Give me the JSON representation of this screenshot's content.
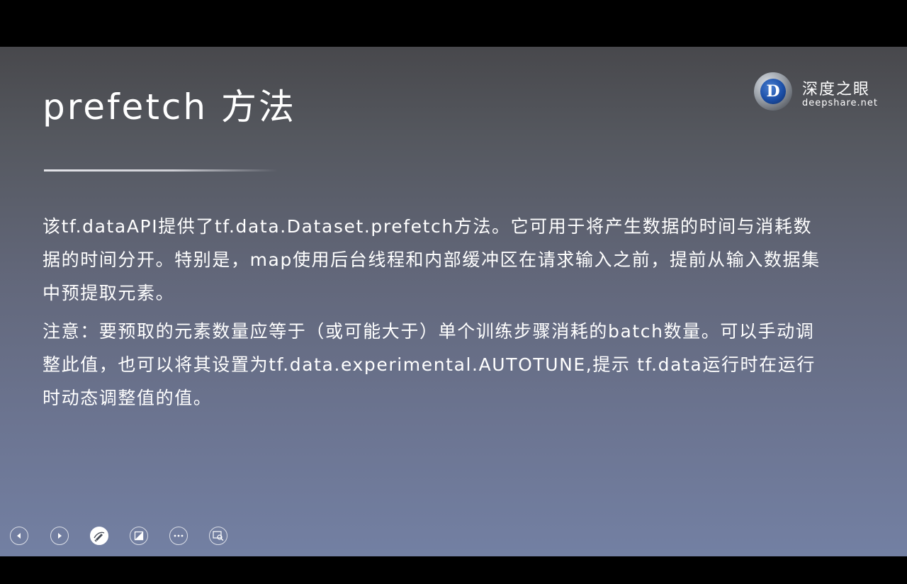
{
  "slide": {
    "title": "prefetch 方法",
    "paragraphs": [
      "该tf.dataAPI提供了tf.data.Dataset.prefetch方法。它可用于将产生数据的时间与消耗数据的时间分开。特别是，map使用后台线程和内部缓冲区在请求输入之前，提前从输入数据集中预提取元素。",
      "注意：要预取的元素数量应等于（或可能大于）单个训练步骤消耗的batch数量。可以手动调整此值，也可以将其设置为tf.data.experimental.AUTOTUNE,提示 tf.data运行时在运行时动态调整值的值。"
    ]
  },
  "logo": {
    "mark_letter": "D",
    "name_cn": "深度之眼",
    "domain": "deepshare.net"
  },
  "controls": [
    {
      "icon": "previous-icon"
    },
    {
      "icon": "next-icon"
    },
    {
      "icon": "pen-icon"
    },
    {
      "icon": "slide-view-icon"
    },
    {
      "icon": "more-icon"
    },
    {
      "icon": "zoom-icon"
    }
  ],
  "colors": {
    "slide_top": "#48484c",
    "slide_bottom": "#7380a3",
    "text": "#ffffff",
    "logo_blue": "#1b4fa8"
  }
}
